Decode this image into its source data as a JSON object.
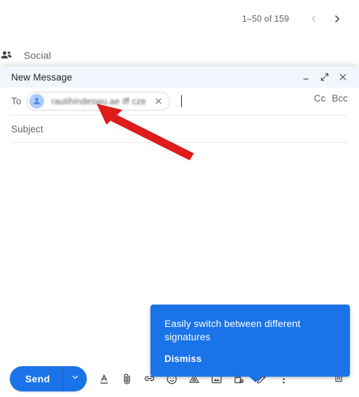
{
  "mailbox": {
    "pagination": {
      "range_text": "1–50 of 159",
      "prev_icon": "chevron-left-icon",
      "next_icon": "chevron-right-icon"
    },
    "tab": {
      "label": "Social",
      "icon": "people-group-icon"
    }
  },
  "compose": {
    "title": "New Message",
    "window_controls": {
      "minimize_icon": "minimize-icon",
      "expand_icon": "expand-diagonal-icon",
      "close_icon": "close-icon"
    },
    "to": {
      "label": "To",
      "recipient_chip": {
        "text": "rautihindeswu.ae  iff  cze",
        "avatar_icon": "person-avatar-icon",
        "remove_icon": "close-icon",
        "redacted": "true"
      }
    },
    "cc_label": "Cc",
    "bcc_label": "Bcc",
    "subject_placeholder": "Subject",
    "body_value": ""
  },
  "tooltip": {
    "message": "Easily switch between different signatures",
    "dismiss_label": "Dismiss",
    "background_color": "#1a73e8"
  },
  "toolbar": {
    "send_label": "Send",
    "send_color": "#1a73e8",
    "send_options_icon": "chevron-down-icon",
    "icons": [
      {
        "name": "format-text-icon",
        "title": "Formatting options"
      },
      {
        "name": "attach-file-icon",
        "title": "Attach files"
      },
      {
        "name": "insert-link-icon",
        "title": "Insert link"
      },
      {
        "name": "insert-emoji-icon",
        "title": "Insert emoji"
      },
      {
        "name": "google-drive-icon",
        "title": "Insert files using Drive"
      },
      {
        "name": "insert-photo-icon",
        "title": "Insert photo"
      },
      {
        "name": "confidential-mode-icon",
        "title": "Toggle confidential mode"
      },
      {
        "name": "signature-pen-icon",
        "title": "Insert signature"
      },
      {
        "name": "more-options-icon",
        "title": "More options"
      }
    ],
    "discard_icon": "trash-icon"
  },
  "annotation": {
    "arrow_color": "#e01b1b",
    "points_to": "recipient-chip"
  }
}
